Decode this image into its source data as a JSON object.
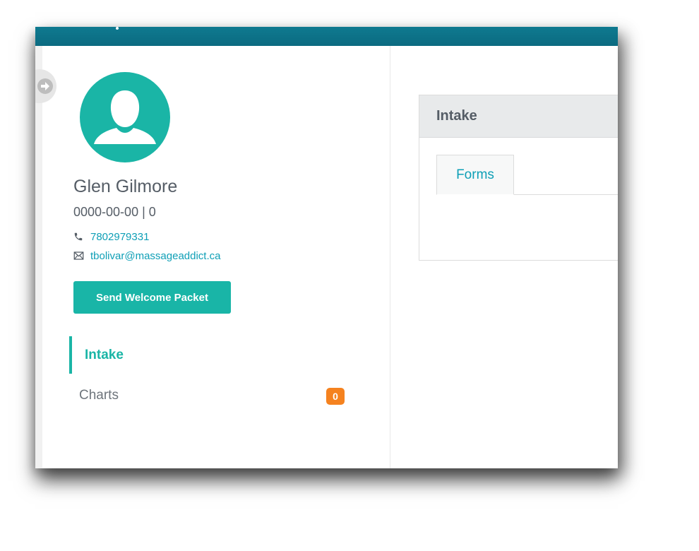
{
  "patient": {
    "name": "Glen Gilmore",
    "dob_line": "0000-00-00 | 0",
    "phone": "7802979331",
    "email": "tbolivar@massageaddict.ca"
  },
  "actions": {
    "welcome_packet_label": "Send Welcome Packet"
  },
  "sidebar": {
    "items": [
      {
        "label": "Intake",
        "active": true
      },
      {
        "label": "Charts",
        "badge": "0"
      }
    ]
  },
  "main": {
    "card_title": "Intake",
    "tabs": [
      {
        "label": "Forms",
        "active": true
      }
    ]
  },
  "colors": {
    "accent": "#1ab5a6",
    "topbar": "#0b6a80",
    "link": "#0e9fb6",
    "badge": "#f5821f"
  },
  "icons": {
    "toggle": "arrow-right-icon",
    "phone": "phone-icon",
    "email": "envelope-icon",
    "avatar": "user-silhouette-icon"
  }
}
